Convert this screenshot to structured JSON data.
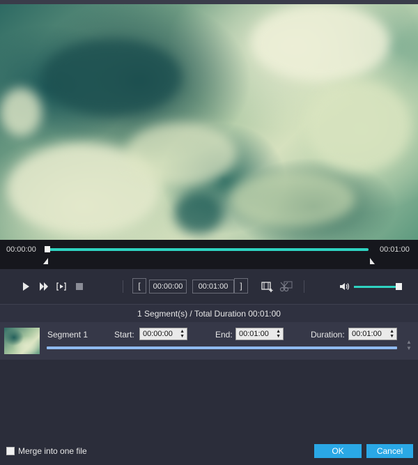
{
  "preview": {
    "icon": "video-preview-image"
  },
  "timeline": {
    "start_time": "00:00:00",
    "end_time": "00:01:00",
    "progress": 0.0
  },
  "controls": {
    "clip_start": "00:00:00",
    "clip_end": "00:01:00",
    "bracket_left": "[",
    "bracket_right": "]",
    "volume": 0.92
  },
  "segments_header": "1 Segment(s) / Total Duration 00:01:00",
  "segment": {
    "name": "Segment 1",
    "start_label": "Start:",
    "start_value": "00:00:00",
    "end_label": "End:",
    "end_value": "00:01:00",
    "duration_label": "Duration:",
    "duration_value": "00:01:00"
  },
  "footer": {
    "merge_label": "Merge into one file",
    "ok_label": "OK",
    "cancel_label": "Cancel"
  },
  "colors": {
    "accent_teal": "#2fd3c1",
    "button_blue": "#2aa8e6",
    "segment_bar": "#8fbaf0",
    "background": "#2b2d3a"
  }
}
